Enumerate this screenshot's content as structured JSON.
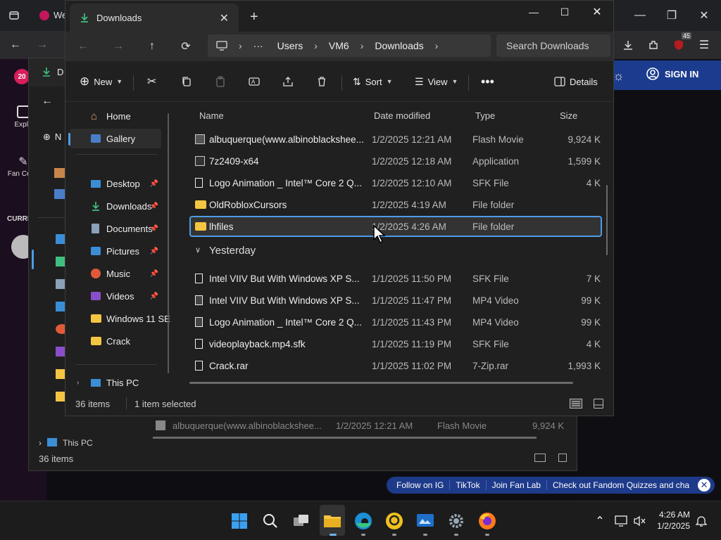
{
  "browser": {
    "tab_partial": "We",
    "badge_count": "45",
    "fandom_side": {
      "explore": "Explo",
      "fan_central": "Fan Centr",
      "current": "CURRE",
      "notif": "20"
    },
    "signin": "SIGN IN",
    "promo": [
      "Follow on IG",
      "TikTok",
      "Join Fan Lab",
      "Check out Fandom Quizzes and cha"
    ]
  },
  "back_window": {
    "tab_initial": "D",
    "new_partial": "N",
    "row": {
      "name": "albuquerque(www.albinoblackshee...",
      "date": "1/2/2025 12:21 AM",
      "type": "Flash Movie",
      "size": "9,924 K"
    },
    "this_pc": "This PC",
    "status": "36 items"
  },
  "explorer": {
    "tab_title": "Downloads",
    "breadcrumb": [
      "Users",
      "VM6",
      "Downloads"
    ],
    "search_placeholder": "Search Downloads",
    "commands": {
      "new": "New",
      "sort": "Sort",
      "view": "View",
      "details": "Details"
    },
    "nav_pane": {
      "home": "Home",
      "gallery": "Gallery",
      "quick": [
        {
          "label": "Desktop",
          "icon": "desktop-icon"
        },
        {
          "label": "Downloads",
          "icon": "download-icon"
        },
        {
          "label": "Documents",
          "icon": "document-icon"
        },
        {
          "label": "Pictures",
          "icon": "pictures-icon"
        },
        {
          "label": "Music",
          "icon": "music-icon"
        },
        {
          "label": "Videos",
          "icon": "videos-icon"
        },
        {
          "label": "Windows 11 SE",
          "icon": "folder-icon"
        },
        {
          "label": "Crack",
          "icon": "folder-icon"
        }
      ],
      "this_pc": "This PC"
    },
    "columns": {
      "name": "Name",
      "date": "Date modified",
      "type": "Type",
      "size": "Size"
    },
    "today_rows": [
      {
        "name": "albuquerque(www.albinoblackshee...",
        "date": "1/2/2025 12:21 AM",
        "type": "Flash Movie",
        "size": "9,924 K",
        "icon": "flash-file-icon"
      },
      {
        "name": "7z2409-x64",
        "date": "1/2/2025 12:18 AM",
        "type": "Application",
        "size": "1,599 K",
        "icon": "app-icon"
      },
      {
        "name": "Logo Animation _ Intel™ Core 2 Q...",
        "date": "1/2/2025 12:10 AM",
        "type": "SFK File",
        "size": "4 K",
        "icon": "file-icon"
      },
      {
        "name": "OldRobloxCursors",
        "date": "1/2/2025 4:19 AM",
        "type": "File folder",
        "size": "",
        "icon": "folder-icon"
      },
      {
        "name": "lhfiles",
        "date": "1/2/2025 4:26 AM",
        "type": "File folder",
        "size": "",
        "icon": "folder-icon"
      }
    ],
    "group_yesterday": "Yesterday",
    "yesterday_rows": [
      {
        "name": "Intel VIIV But With Windows XP S...",
        "date": "1/1/2025 11:50 PM",
        "type": "SFK File",
        "size": "7 K",
        "icon": "file-icon"
      },
      {
        "name": "Intel VIIV But With Windows XP S...",
        "date": "1/1/2025 11:47 PM",
        "type": "MP4 Video",
        "size": "99 K",
        "icon": "video-file-icon"
      },
      {
        "name": "Logo Animation _ Intel™ Core 2 Q...",
        "date": "1/1/2025 11:43 PM",
        "type": "MP4 Video",
        "size": "99 K",
        "icon": "video-file-icon"
      },
      {
        "name": "videoplayback.mp4.sfk",
        "date": "1/1/2025 11:19 PM",
        "type": "SFK File",
        "size": "4 K",
        "icon": "file-icon"
      },
      {
        "name": "Crack.rar",
        "date": "1/1/2025 11:02 PM",
        "type": "7-Zip.rar",
        "size": "1,993 K",
        "icon": "file-icon"
      }
    ],
    "status": {
      "count": "36 items",
      "selected": "1 item selected"
    }
  },
  "taskbar": {
    "time": "4:26 AM",
    "date": "1/2/2025"
  },
  "colors": {
    "accent": "#4f9be8",
    "folder": "#f4c542",
    "download": "#3fbf7f",
    "fandom_blue": "#1e3a8a"
  }
}
